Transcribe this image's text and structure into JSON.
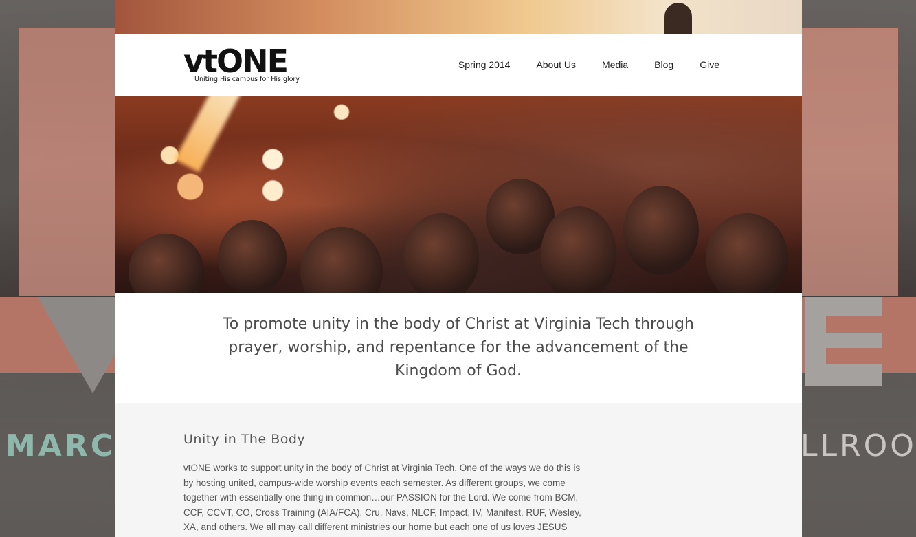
{
  "background": {
    "left_text": "MARCH",
    "right_text": "LLROOM"
  },
  "header": {
    "logo_text": "vtONE",
    "logo_tagline": "Uniting His campus for His glory",
    "nav": [
      {
        "label": "Spring 2014"
      },
      {
        "label": "About Us"
      },
      {
        "label": "Media"
      },
      {
        "label": "Blog"
      },
      {
        "label": "Give"
      }
    ]
  },
  "mission": {
    "text": "To promote unity in the body of Christ at Virginia Tech through prayer, worship, and repentance for the advancement of the Kingdom of God."
  },
  "content": {
    "heading": "Unity in The Body",
    "body": "vtONE works to support unity in the body of Christ at Virginia Tech. One of the ways we do this is by hosting united, campus-wide worship events each semester. As different groups, we come together with essentially one thing in common…our PASSION for the Lord. We come from BCM, CCF, CCVT, CO, Cross Training (AIA/FCA), Cru, Navs, NLCF, Impact, IV, Manifest, RUF, Wesley, XA, and others. We all may call different ministries our home but each one of us loves JESUS with all our heart, all our mind, and all our soul. We gather together with one spirit"
  },
  "colors": {
    "header_bg": "#ffffff",
    "content_bg": "#f5f5f5",
    "text": "#555555"
  }
}
